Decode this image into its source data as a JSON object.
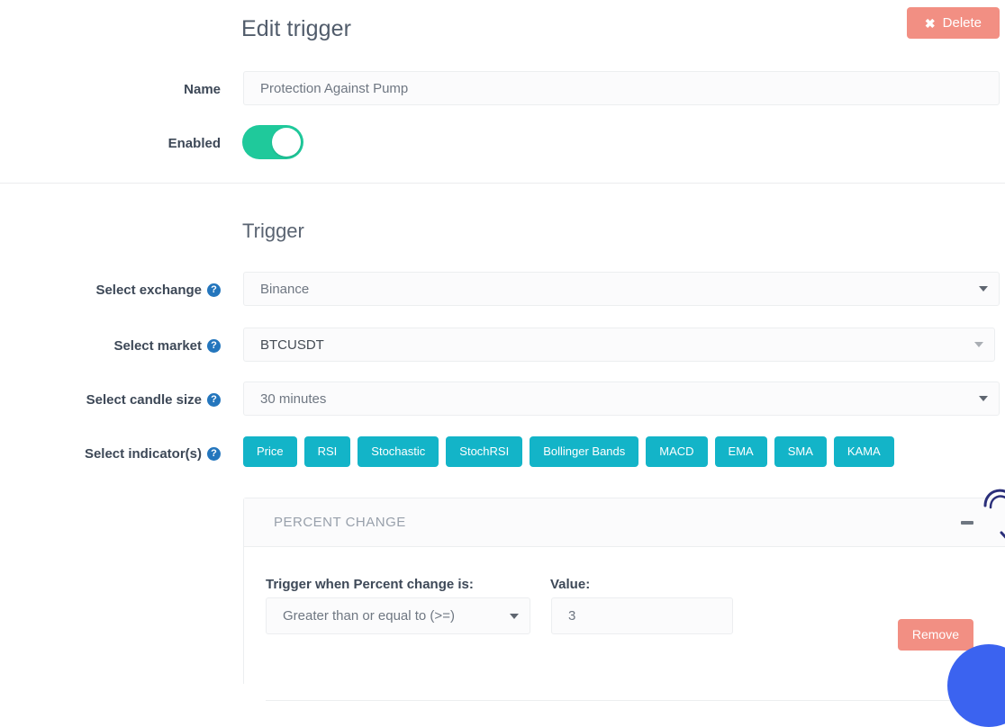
{
  "header": {
    "title": "Edit trigger",
    "delete_label": "Delete",
    "delete_icon": "close-x-icon",
    "delete_color": "#f28f83"
  },
  "general": {
    "name_label": "Name",
    "name_value": "Protection Against Pump",
    "name_placeholder": "Protection Against Pump",
    "enabled_label": "Enabled",
    "enabled_state": "on",
    "toggle_on_color": "#1fc99b"
  },
  "trigger": {
    "section_title": "Trigger",
    "exchange": {
      "label": "Select exchange",
      "help_icon": "question-mark-icon",
      "value": "Binance"
    },
    "market": {
      "label": "Select market",
      "help_icon": "question-mark-icon",
      "value": "BTCUSDT"
    },
    "candle_size": {
      "label": "Select candle size",
      "help_icon": "question-mark-icon",
      "value": "30 minutes"
    },
    "indicators": {
      "label": "Select indicator(s)",
      "help_icon": "question-mark-icon",
      "button_color": "#13b4c8",
      "items": [
        {
          "label": "Price"
        },
        {
          "label": "RSI"
        },
        {
          "label": "Stochastic"
        },
        {
          "label": "StochRSI"
        },
        {
          "label": "Bollinger Bands"
        },
        {
          "label": "MACD"
        },
        {
          "label": "EMA"
        },
        {
          "label": "SMA"
        },
        {
          "label": "KAMA"
        }
      ]
    }
  },
  "percent_change_panel": {
    "title": "PERCENT CHANGE",
    "collapse_icon": "minus-icon",
    "condition_label": "Trigger when Percent change is:",
    "condition_value": "Greater than or equal to (>=)",
    "value_label": "Value:",
    "value": "3",
    "remove_label": "Remove",
    "remove_color": "#f28f83"
  },
  "overlay": {
    "cursor_icon": "pointer-cursor-icon",
    "chat_icon": "chat-support-button",
    "chat_color": "#3b63f0"
  }
}
